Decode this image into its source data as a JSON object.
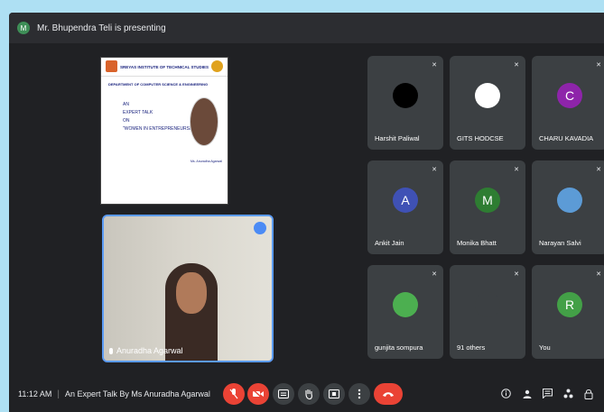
{
  "presenter_bar": {
    "avatar_letter": "M",
    "text": "Mr. Bhupendra Teli is presenting"
  },
  "slide": {
    "institute": "SREYAS INSTITUTE OF TECHNICAL STUDIES",
    "department": "DEPARTMENT OF COMPUTER SCIENCE & ENGINEERING",
    "talk_lines": [
      "AN",
      "EXPERT TALK",
      "ON",
      "\"WOMEN IN ENTREPRENEURSHIP\""
    ],
    "speaker": "Ms. Anuradha Agarwal"
  },
  "self_tile": {
    "name": "Anuradha Agarwal"
  },
  "participants": [
    {
      "name": "Harshit Paliwal",
      "avatar": "",
      "color": "#000000"
    },
    {
      "name": "GITS HODCSE",
      "avatar": "",
      "color": "#ffffff"
    },
    {
      "name": "CHARU KAVADIA",
      "avatar": "C",
      "color": "#8e24aa"
    },
    {
      "name": "Ankit Jain",
      "avatar": "A",
      "color": "#3f51b5"
    },
    {
      "name": "Monika Bhatt",
      "avatar": "M",
      "color": "#2e7d32"
    },
    {
      "name": "Narayan Salvi",
      "avatar": "",
      "color": "#5c9bd6"
    },
    {
      "name": "gunjita sompura",
      "avatar": "",
      "color": "#4caf50"
    },
    {
      "name": "91 others",
      "avatar": "",
      "color": "#3c4043"
    },
    {
      "name": "You",
      "avatar": "R",
      "color": "#43a047"
    }
  ],
  "toolbar": {
    "time": "11:12 AM",
    "separator": "|",
    "meeting_title": "An Expert Talk By Ms Anuradha Agarwal"
  },
  "colors": {
    "accent": "#4b8bf5",
    "danger": "#ea4335",
    "tile_bg": "#3c4043",
    "bg": "#202124"
  }
}
